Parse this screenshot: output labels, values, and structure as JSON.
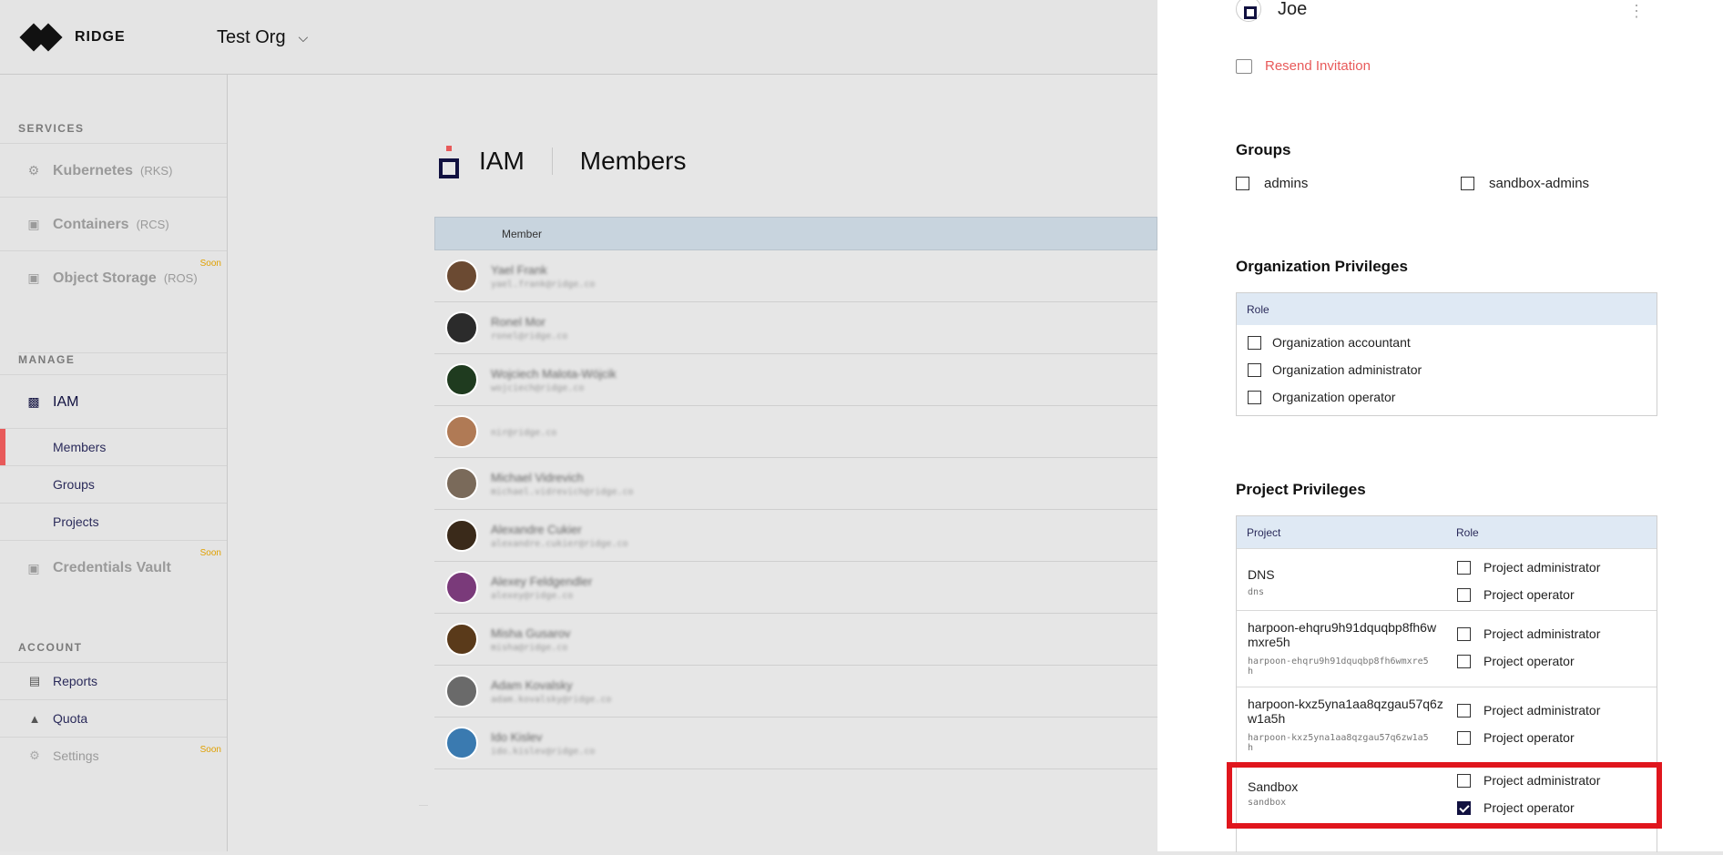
{
  "header": {
    "logo_text": "RIDGE",
    "org_name": "Test Org",
    "org_chevron": "⌄"
  },
  "sidebar": {
    "services_title": "SERVICES",
    "services": [
      {
        "label": "Kubernetes",
        "tag": "(RKS)",
        "icon": "gear-icon",
        "soon": ""
      },
      {
        "label": "Containers",
        "tag": "(RCS)",
        "icon": "container-icon",
        "soon": ""
      },
      {
        "label": "Object Storage",
        "tag": "(ROS)",
        "icon": "storage-icon",
        "soon": "Soon"
      }
    ],
    "manage_title": "MANAGE",
    "iam_label": "IAM",
    "iam_items": [
      "Members",
      "Groups",
      "Projects"
    ],
    "vault_label": "Credentials Vault",
    "vault_soon": "Soon",
    "account_title": "ACCOUNT",
    "account": [
      {
        "label": "Reports",
        "icon": "document-icon",
        "soon": ""
      },
      {
        "label": "Quota",
        "icon": "lock-icon",
        "soon": ""
      },
      {
        "label": "Settings",
        "icon": "gear-icon",
        "soon": "Soon"
      }
    ]
  },
  "main": {
    "title": "IAM",
    "subtitle": "Members",
    "table_header": "Member",
    "members": [
      {
        "name": "Yael Frank",
        "email": "yael.frank@ridge.co",
        "color": "#6b4a32"
      },
      {
        "name": "Ronel Mor",
        "email": "ronel@ridge.co",
        "color": "#2b2b2b"
      },
      {
        "name": "Wojciech Malota-Wójcik",
        "email": "wojciech@ridge.co",
        "color": "#1f3b1f"
      },
      {
        "name": "",
        "email": "nir@ridge.co",
        "color": "#b07a55"
      },
      {
        "name": "Michael Vidrevich",
        "email": "michael.vidrevich@ridge.co",
        "color": "#7a6a5a"
      },
      {
        "name": "Alexandre Cukier",
        "email": "alexandre.cukier@ridge.co",
        "color": "#3a2a1a"
      },
      {
        "name": "Alexey Feldgendler",
        "email": "alexey@ridge.co",
        "color": "#7a3a7a"
      },
      {
        "name": "Misha Gusarov",
        "email": "misha@ridge.co",
        "color": "#5a3a1a"
      },
      {
        "name": "Adam Kovalsky",
        "email": "adam.kovalsky@ridge.co",
        "color": "#6a6a6a"
      },
      {
        "name": "Ido Kislev",
        "email": "ido.kislev@ridge.co",
        "color": "#3a7ab0"
      }
    ]
  },
  "panel": {
    "user_name": "Joe",
    "resend_label": "Resend Invitation",
    "groups_title": "Groups",
    "groups": [
      {
        "label": "admins",
        "checked": false
      },
      {
        "label": "sandbox-admins",
        "checked": false
      }
    ],
    "org_priv_title": "Organization Privileges",
    "org_role_header": "Role",
    "org_roles": [
      "Organization accountant",
      "Organization administrator",
      "Organization operator"
    ],
    "proj_priv_title": "Project Privileges",
    "proj_header_project": "Project",
    "proj_header_role": "Role",
    "projects": [
      {
        "name": "DNS",
        "id": "dns",
        "admin_label": "Project administrator",
        "operator_label": "Project operator",
        "admin_checked": false,
        "operator_checked": false
      },
      {
        "name": "harpoon-ehqru9h91dquqbp8fh6wmxre5h",
        "id": "harpoon-ehqru9h91dquqbp8fh6wmxre5h",
        "admin_label": "Project administrator",
        "operator_label": "Project operator",
        "admin_checked": false,
        "operator_checked": false
      },
      {
        "name": "harpoon-kxz5yna1aa8qzgau57q6zw1a5h",
        "id": "harpoon-kxz5yna1aa8qzgau57q6zw1a5h",
        "admin_label": "Project administrator",
        "operator_label": "Project operator",
        "admin_checked": false,
        "operator_checked": false
      },
      {
        "name": "Sandbox",
        "id": "sandbox",
        "admin_label": "Project administrator",
        "operator_label": "Project operator",
        "admin_checked": false,
        "operator_checked": true
      }
    ]
  }
}
